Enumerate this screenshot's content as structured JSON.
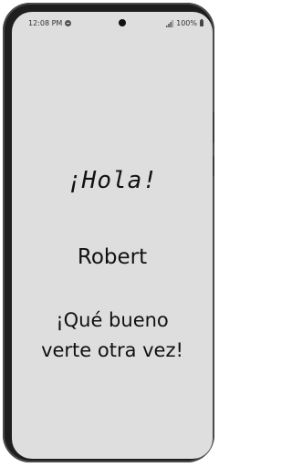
{
  "status_bar": {
    "time": "12:08 PM",
    "battery": "100%",
    "icons": [
      "message-icon",
      "signal-icon",
      "battery-icon"
    ]
  },
  "main": {
    "greeting": "¡Hola!",
    "user_name": "Robert",
    "welcome_line1": "¡Qué bueno",
    "welcome_line2": "verte otra vez!"
  },
  "colors": {
    "screen_background": "#dedede",
    "frame": "#1e1e1e",
    "text": "#111111"
  }
}
